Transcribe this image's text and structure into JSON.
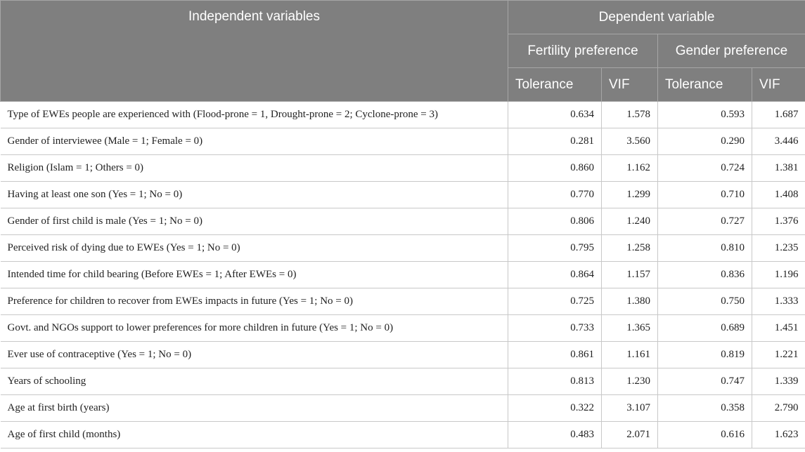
{
  "header": {
    "independent": "Independent variables",
    "dependent": "Dependent variable",
    "fertility": "Fertility preference",
    "gender": "Gender preference",
    "tolerance": "Tolerance",
    "vif": "VIF"
  },
  "rows": [
    {
      "label": "Type of EWEs people are experienced with (Flood-prone = 1, Drought-prone = 2; Cyclone-prone = 3)",
      "ft": "0.634",
      "fv": "1.578",
      "gt": "0.593",
      "gv": "1.687"
    },
    {
      "label": "Gender of interviewee (Male = 1; Female = 0)",
      "ft": "0.281",
      "fv": "3.560",
      "gt": "0.290",
      "gv": "3.446"
    },
    {
      "label": "Religion (Islam = 1; Others = 0)",
      "ft": "0.860",
      "fv": "1.162",
      "gt": "0.724",
      "gv": "1.381"
    },
    {
      "label": "Having at least one son (Yes = 1; No = 0)",
      "ft": "0.770",
      "fv": "1.299",
      "gt": "0.710",
      "gv": "1.408"
    },
    {
      "label": "Gender of first child is male (Yes = 1; No = 0)",
      "ft": "0.806",
      "fv": "1.240",
      "gt": "0.727",
      "gv": "1.376"
    },
    {
      "label": "Perceived risk of dying due to EWEs (Yes = 1; No = 0)",
      "ft": "0.795",
      "fv": "1.258",
      "gt": "0.810",
      "gv": "1.235"
    },
    {
      "label": "Intended time for child bearing (Before EWEs = 1; After EWEs = 0)",
      "ft": "0.864",
      "fv": "1.157",
      "gt": "0.836",
      "gv": "1.196"
    },
    {
      "label": "Preference for children to recover from EWEs impacts in future (Yes = 1; No = 0)",
      "ft": "0.725",
      "fv": "1.380",
      "gt": "0.750",
      "gv": "1.333"
    },
    {
      "label": "Govt. and NGOs support to lower preferences for more children in future (Yes = 1; No = 0)",
      "ft": "0.733",
      "fv": "1.365",
      "gt": "0.689",
      "gv": "1.451"
    },
    {
      "label": "Ever use of contraceptive (Yes = 1; No = 0)",
      "ft": "0.861",
      "fv": "1.161",
      "gt": "0.819",
      "gv": "1.221"
    },
    {
      "label": "Years of schooling",
      "ft": "0.813",
      "fv": "1.230",
      "gt": "0.747",
      "gv": "1.339"
    },
    {
      "label": "Age at first birth (years)",
      "ft": "0.322",
      "fv": "3.107",
      "gt": "0.358",
      "gv": "2.790"
    },
    {
      "label": "Age of first child (months)",
      "ft": "0.483",
      "fv": "2.071",
      "gt": "0.616",
      "gv": "1.623"
    }
  ]
}
